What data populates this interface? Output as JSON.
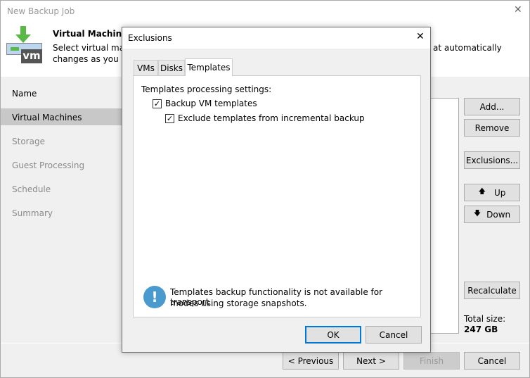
{
  "window": {
    "title": "New Backup Job",
    "close": "✕"
  },
  "header": {
    "title": "Virtual Machines",
    "desc1": "Select virtual mach",
    "desc1_tail": "at automatically",
    "desc2": "changes as you ad",
    "icon_text": "vm"
  },
  "nav": [
    "Name",
    "Virtual Machines",
    "Storage",
    "Guest Processing",
    "Schedule",
    "Summary"
  ],
  "right_buttons": {
    "add": "Add...",
    "remove": "Remove",
    "exclusions": "Exclusions...",
    "up": "Up",
    "down": "Down",
    "recalculate": "Recalculate"
  },
  "total": {
    "label": "Total size:",
    "value": "247 GB"
  },
  "footer": {
    "previous": "< Previous",
    "next": "Next >",
    "finish": "Finish",
    "cancel": "Cancel"
  },
  "dialog": {
    "title": "Exclusions",
    "close": "✕",
    "tabs": [
      "VMs",
      "Disks",
      "Templates"
    ],
    "group_label": "Templates processing settings:",
    "cb1": "Backup VM templates",
    "cb2": "Exclude templates from incremental backup",
    "info1": "Templates backup functionality is not available for transport",
    "info2": "modes using storage snapshots.",
    "ok": "OK",
    "cancel": "Cancel",
    "check": "✓"
  }
}
